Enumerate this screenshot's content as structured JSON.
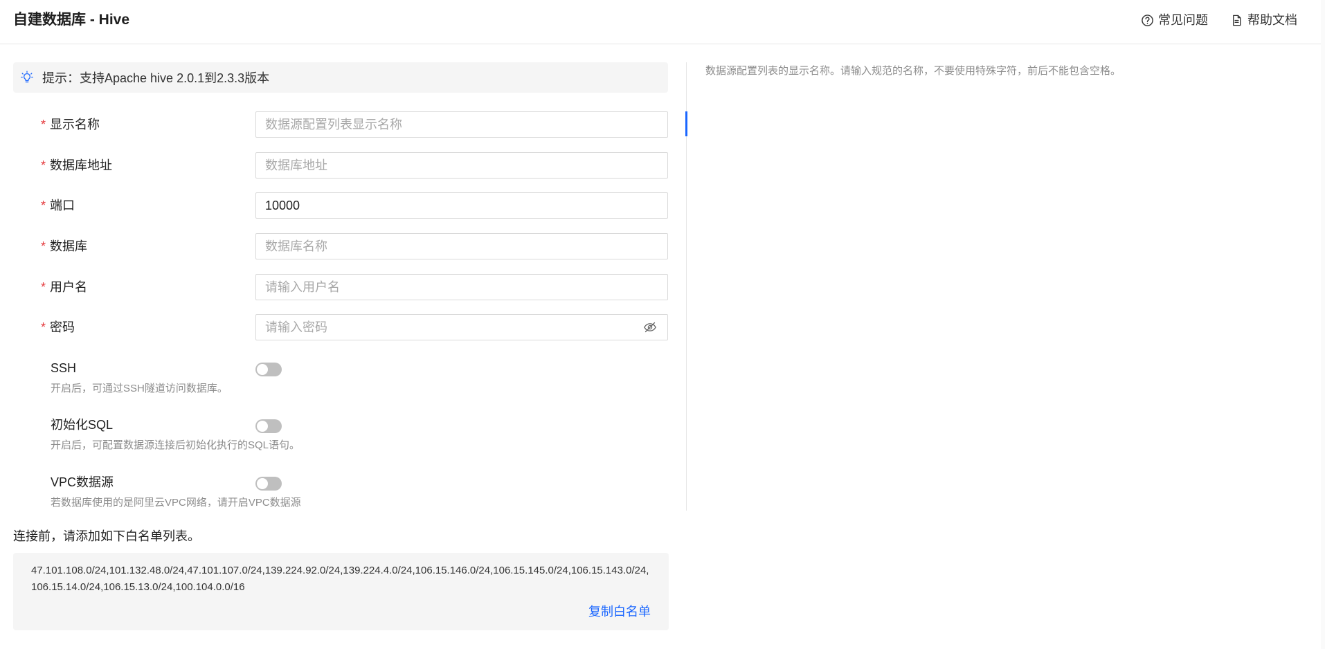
{
  "header": {
    "title": "自建数据库 - Hive",
    "faq_label": "常见问题",
    "docs_label": "帮助文档"
  },
  "tip": {
    "text": "提示：支持Apache hive 2.0.1到2.3.3版本"
  },
  "form": {
    "display_name": {
      "label": "显示名称",
      "placeholder": "数据源配置列表显示名称",
      "value": ""
    },
    "db_address": {
      "label": "数据库地址",
      "placeholder": "数据库地址",
      "value": ""
    },
    "port": {
      "label": "端口",
      "placeholder": "",
      "value": "10000"
    },
    "database": {
      "label": "数据库",
      "placeholder": "数据库名称",
      "value": ""
    },
    "username": {
      "label": "用户名",
      "placeholder": "请输入用户名",
      "value": ""
    },
    "password": {
      "label": "密码",
      "placeholder": "请输入密码",
      "value": ""
    },
    "required_mark": "*"
  },
  "toggles": {
    "ssh": {
      "label": "SSH",
      "desc": "开启后，可通过SSH隧道访问数据库。",
      "on": false
    },
    "init_sql": {
      "label": "初始化SQL",
      "desc": "开启后，可配置数据源连接后初始化执行的SQL语句。",
      "on": false
    },
    "vpc": {
      "label": "VPC数据源",
      "desc": "若数据库使用的是阿里云VPC网络，请开启VPC数据源",
      "on": false
    }
  },
  "whitelist": {
    "label": "连接前，请添加如下白名单列表。",
    "ips": "47.101.108.0/24,101.132.48.0/24,47.101.107.0/24,139.224.92.0/24,139.224.4.0/24,106.15.146.0/24,106.15.145.0/24,106.15.143.0/24,106.15.14.0/24,106.15.13.0/24,100.104.0.0/16",
    "copy_label": "复制白名单"
  },
  "help": {
    "text": "数据源配置列表的显示名称。请输入规范的名称，不要使用特殊字符，前后不能包含空格。"
  },
  "colors": {
    "accent": "#1a66ff",
    "required": "#e4393c",
    "muted": "#8c8c8c",
    "tip_bg": "#f5f5f5"
  },
  "icons": {
    "faq": "question-circle-icon",
    "docs": "document-icon",
    "tip": "lightbulb-icon",
    "password_toggle": "eye-slash-icon"
  }
}
